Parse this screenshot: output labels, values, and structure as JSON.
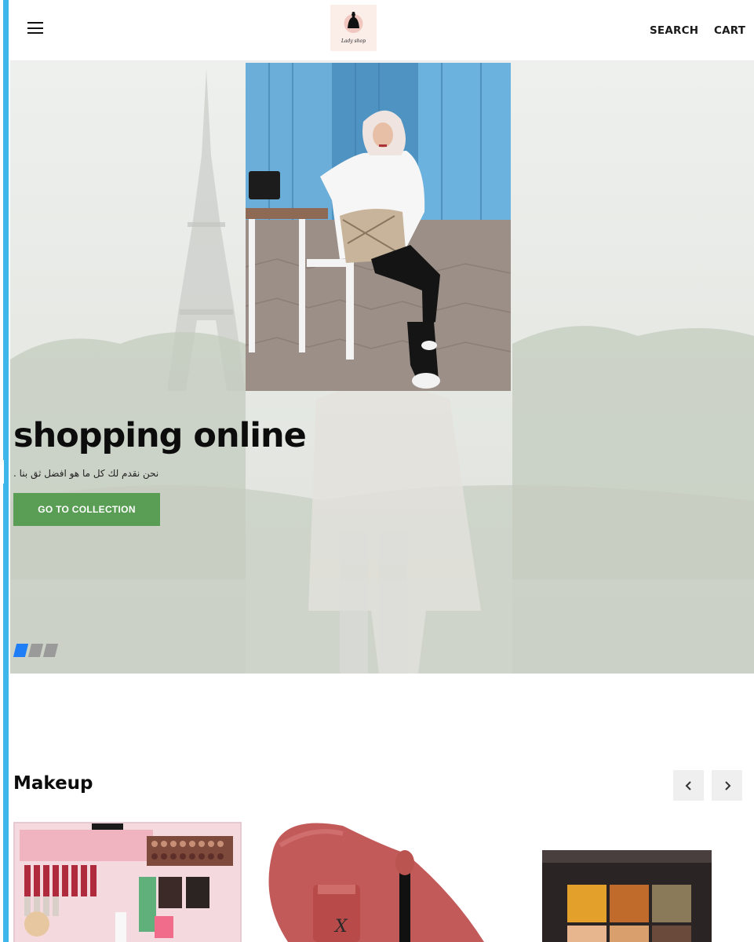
{
  "header": {
    "menu_icon": "hamburger-icon",
    "logo_alt": "Lady shop logo",
    "search_label": "SEARCH",
    "cart_label": "CART"
  },
  "hero": {
    "title": "shopping online",
    "subtitle": "نحن نقدم لك كل ما هو افضل ثق بنا .",
    "button_label": "GO TO COLLECTION",
    "slides_count": 3,
    "active_slide": 1,
    "button_color": "#5a9e55",
    "active_dot_color": "#1f7ef5"
  },
  "section": {
    "title": "Makeup",
    "prev_icon": "chevron-left-icon",
    "next_icon": "chevron-right-icon",
    "products": [
      {
        "image": "makeup-kit-image"
      },
      {
        "image": "lip-gloss-image"
      },
      {
        "image": "eyeshadow-palette-image"
      }
    ]
  },
  "colors": {
    "accent_blue": "#3fb6ea"
  }
}
